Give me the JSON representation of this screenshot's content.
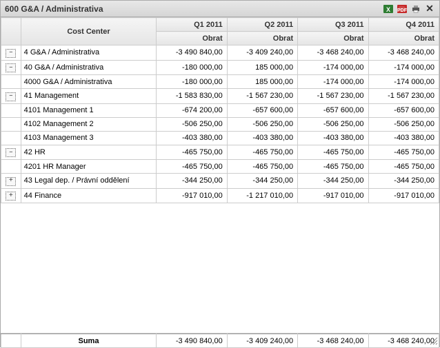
{
  "title": "600 G&A / Administrativa",
  "headers": {
    "cost_center": "Cost Center",
    "periods": [
      "Q1 2011",
      "Q2 2011",
      "Q3 2011",
      "Q4 2011"
    ],
    "metric": "Obrat"
  },
  "rows": [
    {
      "expand": "–",
      "label": "4 G&A / Administrativa",
      "q": [
        "-3 490 840,00",
        "-3 409 240,00",
        "-3 468 240,00",
        "-3 468 240,00"
      ]
    },
    {
      "expand": "–",
      "label": "40 G&A / Administrativa",
      "q": [
        "-180 000,00",
        "185 000,00",
        "-174 000,00",
        "-174 000,00"
      ]
    },
    {
      "expand": "",
      "label": "4000 G&A / Administrativa",
      "q": [
        "-180 000,00",
        "185 000,00",
        "-174 000,00",
        "-174 000,00"
      ]
    },
    {
      "expand": "–",
      "label": "41 Management",
      "q": [
        "-1 583 830,00",
        "-1 567 230,00",
        "-1 567 230,00",
        "-1 567 230,00"
      ]
    },
    {
      "expand": "",
      "label": "4101 Management 1",
      "q": [
        "-674 200,00",
        "-657 600,00",
        "-657 600,00",
        "-657 600,00"
      ]
    },
    {
      "expand": "",
      "label": "4102 Management 2",
      "q": [
        "-506 250,00",
        "-506 250,00",
        "-506 250,00",
        "-506 250,00"
      ]
    },
    {
      "expand": "",
      "label": "4103 Management 3",
      "q": [
        "-403 380,00",
        "-403 380,00",
        "-403 380,00",
        "-403 380,00"
      ]
    },
    {
      "expand": "–",
      "label": "42 HR",
      "q": [
        "-465 750,00",
        "-465 750,00",
        "-465 750,00",
        "-465 750,00"
      ]
    },
    {
      "expand": "",
      "label": "4201 HR Manager",
      "q": [
        "-465 750,00",
        "-465 750,00",
        "-465 750,00",
        "-465 750,00"
      ]
    },
    {
      "expand": "+",
      "label": "43 Legal dep. / Právní oddělení",
      "q": [
        "-344 250,00",
        "-344 250,00",
        "-344 250,00",
        "-344 250,00"
      ]
    },
    {
      "expand": "+",
      "label": "44 Finance",
      "q": [
        "-917 010,00",
        "-1 217 010,00",
        "-917 010,00",
        "-917 010,00"
      ]
    }
  ],
  "footer": {
    "label": "Suma",
    "q": [
      "-3 490 840,00",
      "-3 409 240,00",
      "-3 468 240,00",
      "-3 468 240,00"
    ]
  },
  "chart_data": {
    "type": "table",
    "title": "600 G&A / Administrativa",
    "columns": [
      "Cost Center",
      "Q1 2011 Obrat",
      "Q2 2011 Obrat",
      "Q3 2011 Obrat",
      "Q4 2011 Obrat"
    ],
    "rows": [
      [
        "4 G&A / Administrativa",
        -3490840.0,
        -3409240.0,
        -3468240.0,
        -3468240.0
      ],
      [
        "40 G&A / Administrativa",
        -180000.0,
        185000.0,
        -174000.0,
        -174000.0
      ],
      [
        "4000 G&A / Administrativa",
        -180000.0,
        185000.0,
        -174000.0,
        -174000.0
      ],
      [
        "41 Management",
        -1583830.0,
        -1567230.0,
        -1567230.0,
        -1567230.0
      ],
      [
        "4101 Management 1",
        -674200.0,
        -657600.0,
        -657600.0,
        -657600.0
      ],
      [
        "4102 Management 2",
        -506250.0,
        -506250.0,
        -506250.0,
        -506250.0
      ],
      [
        "4103 Management 3",
        -403380.0,
        -403380.0,
        -403380.0,
        -403380.0
      ],
      [
        "42 HR",
        -465750.0,
        -465750.0,
        -465750.0,
        -465750.0
      ],
      [
        "4201 HR Manager",
        -465750.0,
        -465750.0,
        -465750.0,
        -465750.0
      ],
      [
        "43 Legal dep. / Právní oddělení",
        -344250.0,
        -344250.0,
        -344250.0,
        -344250.0
      ],
      [
        "44 Finance",
        -917010.0,
        -1217010.0,
        -917010.0,
        -917010.0
      ]
    ],
    "totals": [
      "Suma",
      -3490840.0,
      -3409240.0,
      -3468240.0,
      -3468240.0
    ]
  }
}
